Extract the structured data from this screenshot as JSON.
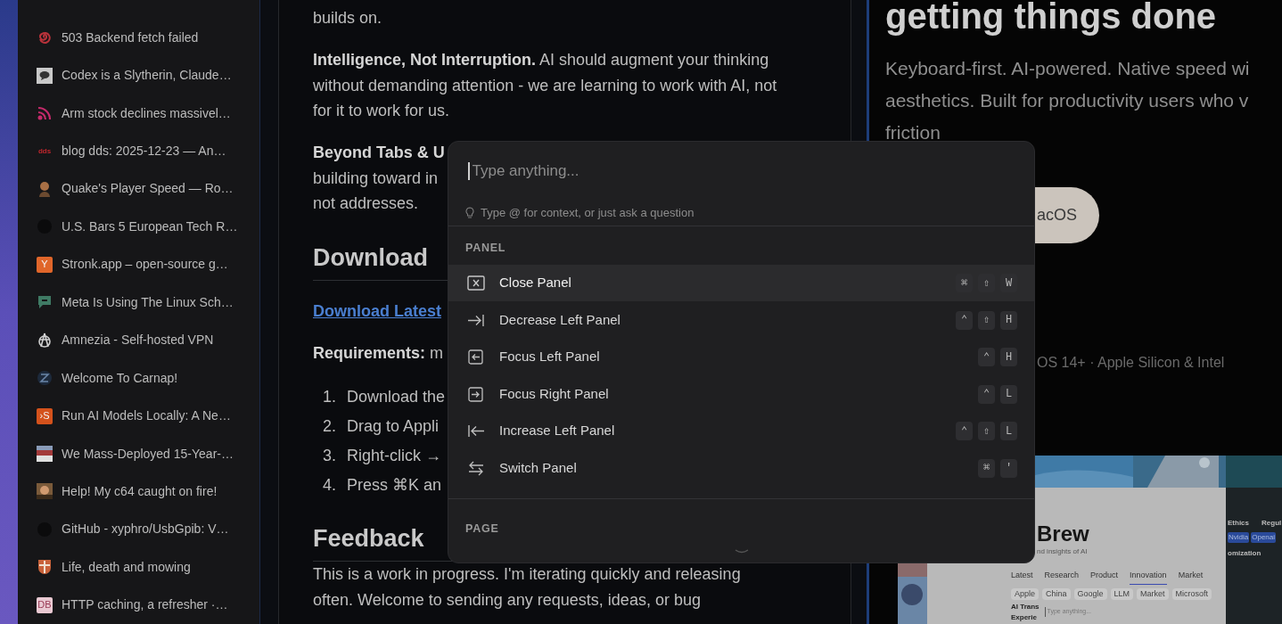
{
  "sidebar": {
    "items": [
      {
        "title": "503 Backend fetch failed",
        "kind": "spiral"
      },
      {
        "title": "Codex is a Slytherin, Claude…",
        "kind": "chat"
      },
      {
        "title": "Arm stock declines massivel…",
        "kind": "feed"
      },
      {
        "title": "blog dds: 2025-12-23 — An…",
        "kind": "wordmark",
        "badge": "dds",
        "color": "#c0262d"
      },
      {
        "title": "Quake's Player Speed — Ro…",
        "kind": "figure"
      },
      {
        "title": "U.S. Bars 5 European Tech R…",
        "kind": "dark"
      },
      {
        "title": "Stronk.app – open-source g…",
        "kind": "letter",
        "badge": "Y",
        "color": "#e0662a"
      },
      {
        "title": "Meta Is Using The Linux Sch…",
        "kind": "bubble"
      },
      {
        "title": "Amnezia - Self-hosted VPN",
        "kind": "star"
      },
      {
        "title": "Welcome To Carnap!",
        "kind": "globe"
      },
      {
        "title": "Run AI Models Locally: A Ne…",
        "kind": "letter",
        "badge": "›S",
        "color": "#d4521c"
      },
      {
        "title": "We Mass-Deployed 15-Year-…",
        "kind": "thumb"
      },
      {
        "title": "Help! My c64 caught on fire!",
        "kind": "thumb"
      },
      {
        "title": "GitHub - xyphro/UsbGpib: V…",
        "kind": "dark"
      },
      {
        "title": "Life, death and mowing",
        "kind": "shield"
      },
      {
        "title": "HTTP caching, a refresher ·…",
        "kind": "letter",
        "badge": "DB",
        "color": "#e9c9d2"
      }
    ]
  },
  "article": {
    "blocks": [
      {
        "kind": "paragraph",
        "lines": [
          "builds on."
        ]
      },
      {
        "kind": "paragraph",
        "lines": [
          "**Intelligence, Not Interruption.** AI should augment your thinking",
          "without demanding attention - we are learning to work with AI, not",
          "for it to work for us."
        ]
      },
      {
        "kind": "paragraph",
        "lines": [
          "**Beyond Tabs & U**",
          "building toward in",
          "not addresses."
        ]
      },
      {
        "kind": "heading",
        "text": "Download"
      },
      {
        "kind": "link",
        "text": "Download Latest"
      },
      {
        "kind": "paragraph",
        "lines": [
          "**Requirements:** m"
        ]
      },
      {
        "kind": "list",
        "items": [
          {
            "number": "1.",
            "text": "Download the"
          },
          {
            "number": "2.",
            "text": "Drag to Appli"
          },
          {
            "number": "3.",
            "text": "Right-click →"
          },
          {
            "number": "4.",
            "text": "Press ⌘K an"
          }
        ]
      },
      {
        "kind": "heading",
        "text": "Feedback"
      },
      {
        "kind": "paragraph",
        "lines": [
          "This is a work in progress. I'm iterating quickly and releasing",
          "often. Welcome to sending any requests, ideas, or bug"
        ]
      }
    ]
  },
  "landing": {
    "heading": "getting things done",
    "lines": [
      "Keyboard-first. AI-powered. Native speed wi",
      "aesthetics. Built for productivity users who v",
      "friction"
    ],
    "button": "acOS",
    "requirements": "OS 14+ · Apple Silicon & Intel",
    "preview": {
      "title": "Brew",
      "subtitle": "nd insights of AI",
      "tabs": [
        {
          "label": "Latest",
          "selected": false
        },
        {
          "label": "Research",
          "selected": false
        },
        {
          "label": "Product",
          "selected": false
        },
        {
          "label": "Innovation",
          "selected": true
        },
        {
          "label": "Market",
          "selected": false
        }
      ],
      "chips": [
        "Apple",
        "China",
        "Google",
        "LLM",
        "Market",
        "Microsoft"
      ],
      "story": [
        "AI Trans",
        "Experie"
      ],
      "search_placeholder": "Type anything...",
      "side_tabs": [
        "Ethics",
        "Regul"
      ],
      "side_chips": [
        "Nvidia",
        "Openai"
      ],
      "side_heading": "omization"
    }
  },
  "palette": {
    "placeholder": "Type anything...",
    "hint": "Type @ for context, or just ask a question",
    "sections": [
      {
        "title": "PANEL",
        "items": [
          {
            "label": "Close Panel",
            "kind": "close",
            "selected": true,
            "keys": [
              "⌘",
              "⇧",
              "W"
            ]
          },
          {
            "label": "Decrease Left Panel",
            "kind": "arrow-right-bar",
            "selected": false,
            "keys": [
              "⌃",
              "⇧",
              "H"
            ]
          },
          {
            "label": "Focus Left Panel",
            "kind": "box-left",
            "selected": false,
            "keys": [
              "⌃",
              "H"
            ]
          },
          {
            "label": "Focus Right Panel",
            "kind": "box-right",
            "selected": false,
            "keys": [
              "⌃",
              "L"
            ]
          },
          {
            "label": "Increase Left Panel",
            "kind": "arrow-left-bar",
            "selected": false,
            "keys": [
              "⌃",
              "⇧",
              "L"
            ]
          },
          {
            "label": "Switch Panel",
            "kind": "swap",
            "selected": false,
            "keys": [
              "⌘",
              "'"
            ]
          }
        ]
      },
      {
        "title": "PAGE"
      }
    ]
  }
}
